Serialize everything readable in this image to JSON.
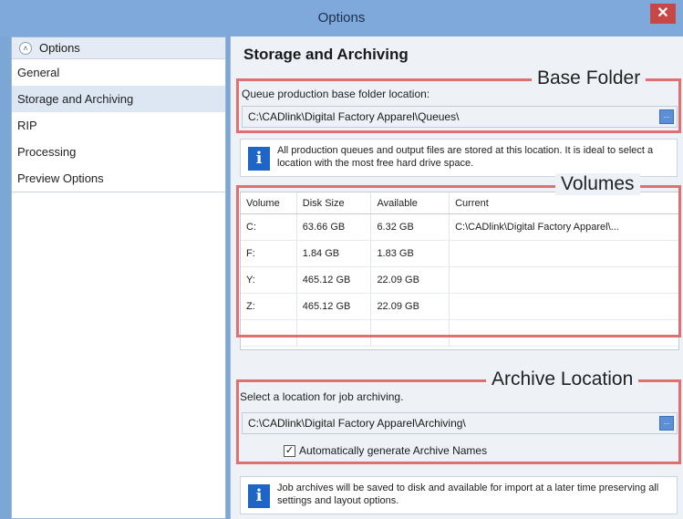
{
  "window": {
    "title": "Options",
    "close_label": "✕"
  },
  "sidebar": {
    "header": "Options",
    "items": [
      {
        "label": "General"
      },
      {
        "label": "Storage and Archiving",
        "active": true
      },
      {
        "label": "RIP"
      },
      {
        "label": "Processing"
      },
      {
        "label": "Preview Options"
      }
    ]
  },
  "main": {
    "section_title": "Storage and Archiving",
    "base_folder": {
      "callout": "Base Folder",
      "label": "Queue production base folder location:",
      "value": "C:\\CADlink\\Digital Factory Apparel\\Queues\\",
      "browse_label": "...",
      "info": "All production queues and output files are stored at this location. It is ideal to select a location with the most free hard drive space."
    },
    "volumes": {
      "callout": "Volumes",
      "columns": [
        "Volume",
        "Disk Size",
        "Available",
        "Current"
      ],
      "rows": [
        [
          "C:",
          "63.66 GB",
          "6.32 GB",
          "C:\\CADlink\\Digital Factory Apparel\\..."
        ],
        [
          "F:",
          "1.84 GB",
          "1.83 GB",
          ""
        ],
        [
          "Y:",
          "465.12 GB",
          "22.09 GB",
          ""
        ],
        [
          "Z:",
          "465.12 GB",
          "22.09 GB",
          ""
        ]
      ]
    },
    "archive": {
      "callout": "Archive Location",
      "label": "Select a location for job archiving.",
      "value": "C:\\CADlink\\Digital Factory Apparel\\Archiving\\",
      "browse_label": "...",
      "checkbox_label": "Automatically generate Archive Names",
      "checkbox_checked": true,
      "info": "Job archives will be saved to disk and available for import at a later time preserving all settings and layout options."
    }
  },
  "colors": {
    "titlebar": "#7fa9db",
    "callout": "#e07070",
    "info_icon": "#1f64c7"
  }
}
